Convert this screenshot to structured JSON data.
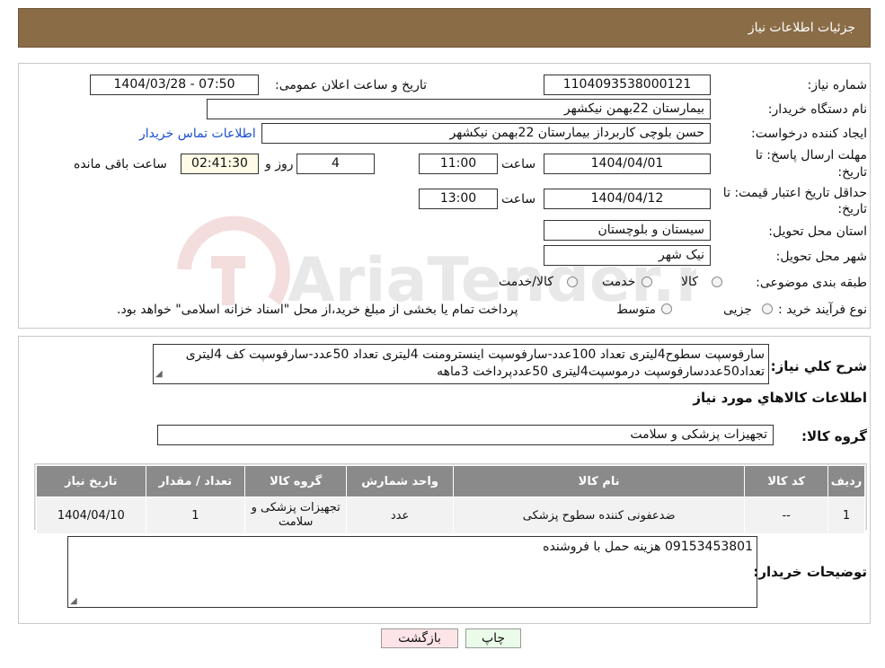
{
  "header": {
    "title": "جزئیات اطلاعات نیاز"
  },
  "fields": {
    "need_number_label": "شماره نیاز:",
    "need_number": "1104093538000121",
    "announce_label": "تاریخ و ساعت اعلان عمومی:",
    "announce_value": "1404/03/28 - 07:50",
    "buyer_label": "نام دستگاه خریدار:",
    "buyer_value": "بیمارستان 22بهمن نیکشهر",
    "creator_label": "ایجاد کننده درخواست:",
    "creator_value": "حسن بلوچی کاربرداز  بیمارستان 22بهمن نیکشهر",
    "contact_link": "اطلاعات تماس خریدار",
    "deadline_label_1": "مهلت ارسال پاسخ: تا",
    "deadline_label_2": "تاریخ:",
    "deadline_date": "1404/04/01",
    "time_label": "ساعت",
    "deadline_time": "11:00",
    "days_value": "4",
    "days_label": "روز و",
    "remaining_value": "02:41:30",
    "remaining_label": "ساعت باقی مانده",
    "validity_label_1": "حداقل تاریخ اعتبار قیمت: تا",
    "validity_label_2": "تاریخ:",
    "validity_date": "1404/04/12",
    "validity_time": "13:00",
    "province_label": "استان محل تحویل:",
    "province_value": "سیستان و بلوچستان",
    "city_label": "شهر محل تحویل:",
    "city_value": "نیک شهر",
    "category_label": "طبقه بندی موضوعی:",
    "category_options": [
      "کالا",
      "خدمت",
      "کالا/خدمت"
    ],
    "process_label": "نوع فرآیند خرید :",
    "process_options": [
      "جزیی",
      "متوسط"
    ],
    "process_note": "پرداخت تمام یا بخشی از مبلغ خرید،از محل \"اسناد خزانه اسلامی\" خواهد بود."
  },
  "description": {
    "label": "شرح کلي نياز:",
    "line1": "سارفوسپت سطوح4لیتری تعداد 100عدد-سارفوسپت اینسترومنت 4لیتری تعداد 50عدد-سارفوسپت کف 4لیتری",
    "line2": "تعداد50عددسارفوسپت درموسپت4لیتری 50عددپرداخت 3ماهه"
  },
  "goods_section": {
    "title": "اطلاعات کالاهاي مورد نياز",
    "group_label": "گروه کالا:",
    "group_value": "تجهیزات پزشکی و سلامت"
  },
  "table": {
    "headers": [
      "ردیف",
      "کد کالا",
      "نام کالا",
      "واحد شمارش",
      "گروه کالا",
      "تعداد / مقدار",
      "تاریخ نیاز"
    ],
    "rows": [
      [
        "1",
        "--",
        "ضدعفونی کننده سطوح پزشکی",
        "عدد",
        "تجهیزات پزشکی و سلامت",
        "1",
        "1404/04/10"
      ]
    ]
  },
  "buyer_notes": {
    "label": "توضیحات خریدار:",
    "value": "09153453801 هزینه حمل با فروشنده"
  },
  "buttons": {
    "print": "چاپ",
    "back": "بازگشت"
  },
  "watermark": {
    "text": "AriaTender.neT"
  },
  "colors": {
    "header_bg": "#8a6d47",
    "table_header_bg": "#8a8a8a",
    "link": "#1a4fd0"
  }
}
